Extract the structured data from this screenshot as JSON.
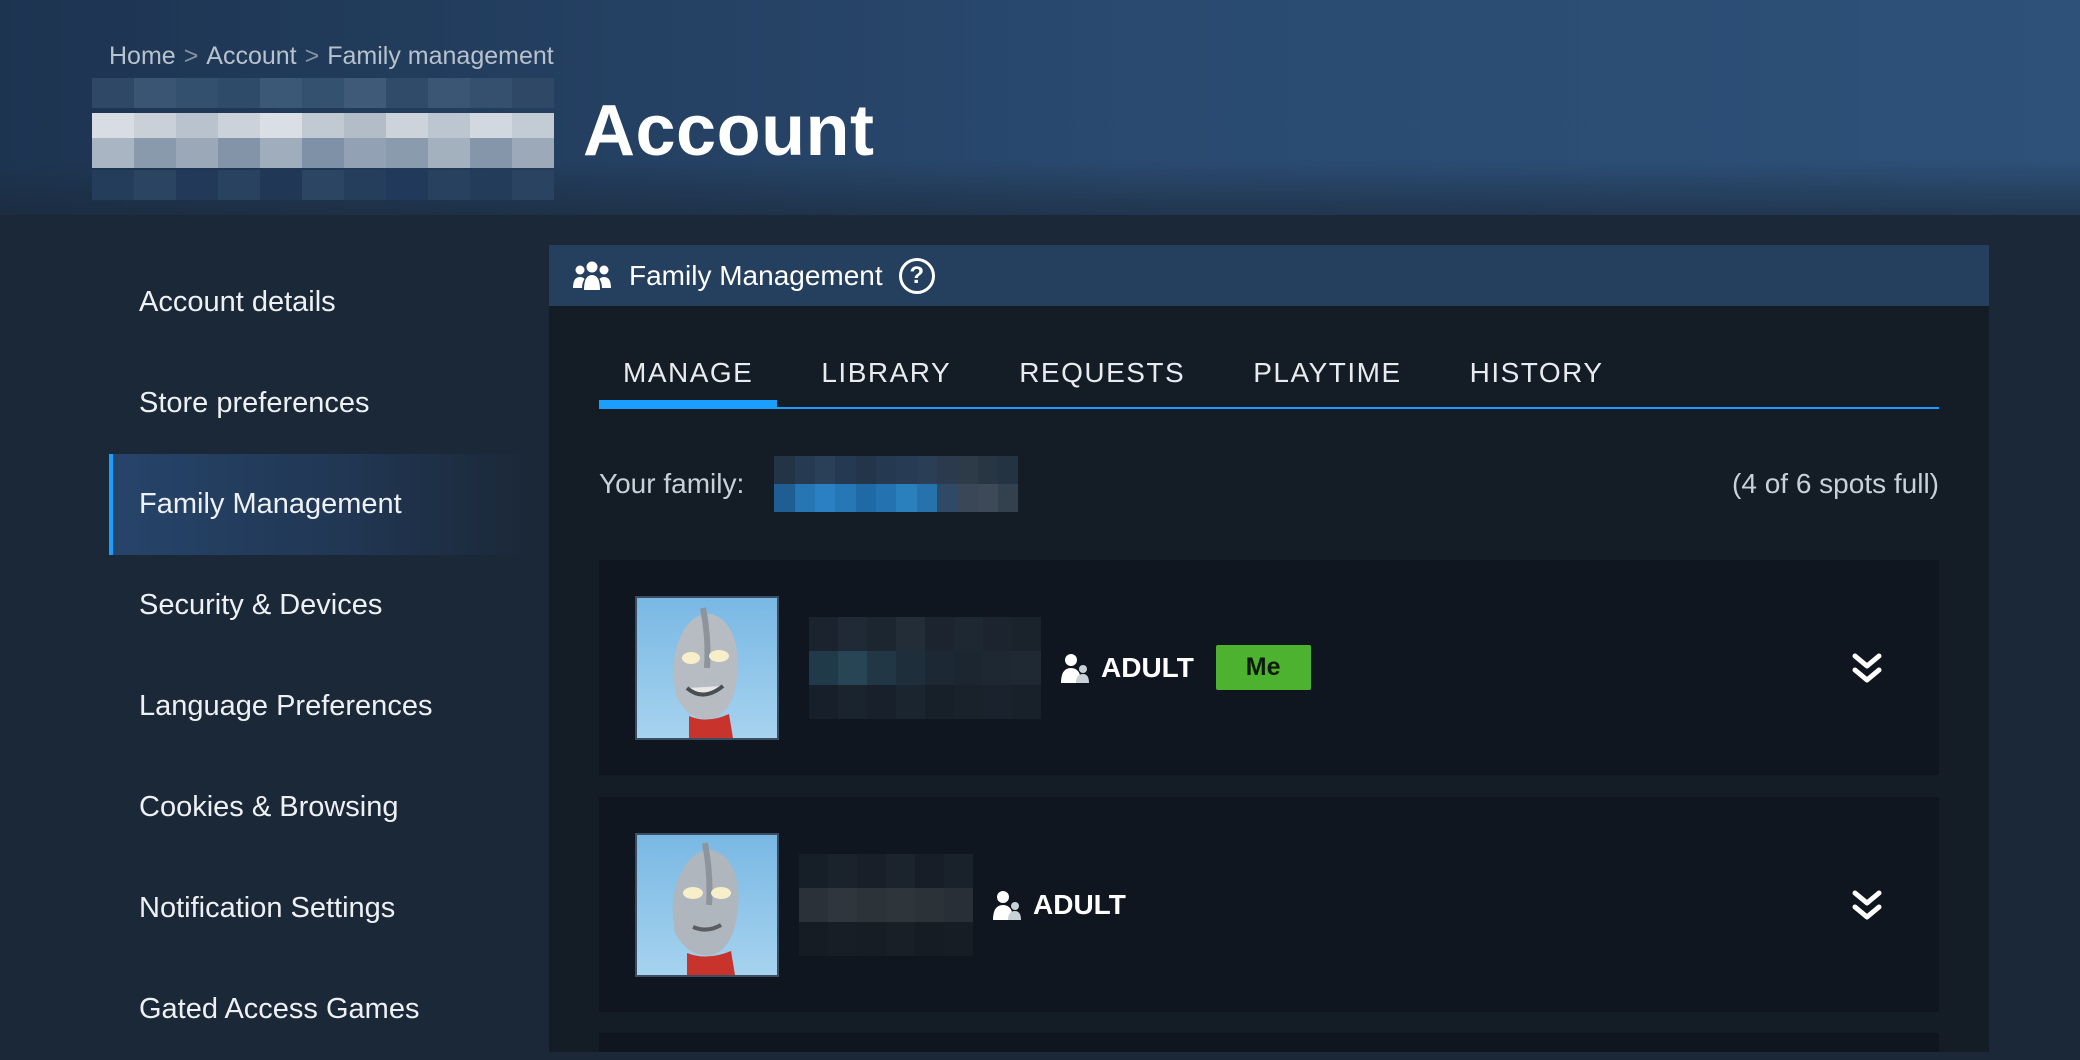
{
  "breadcrumb": [
    "Home",
    "Account",
    "Family management"
  ],
  "breadcrumb_sep": ">",
  "page_title": "Account",
  "sidebar": {
    "items": [
      {
        "label": "Account details"
      },
      {
        "label": "Store preferences"
      },
      {
        "label": "Family Management",
        "active": true
      },
      {
        "label": "Security & Devices"
      },
      {
        "label": "Language Preferences"
      },
      {
        "label": "Cookies & Browsing"
      },
      {
        "label": "Notification Settings"
      },
      {
        "label": "Gated Access Games"
      }
    ]
  },
  "panel": {
    "title": "Family Management",
    "help_label": "?",
    "tabs": [
      {
        "label": "MANAGE",
        "active": true
      },
      {
        "label": "LIBRARY"
      },
      {
        "label": "REQUESTS"
      },
      {
        "label": "PLAYTIME"
      },
      {
        "label": "HISTORY"
      }
    ],
    "family_label": "Your family:",
    "spots_text": "(4 of 6 spots full)",
    "members": [
      {
        "role": "ADULT",
        "badge": "Me"
      },
      {
        "role": "ADULT"
      }
    ]
  },
  "colors": {
    "accent": "#1a9fff",
    "me_badge": "#4cb230",
    "panel_header": "#253f5e"
  }
}
